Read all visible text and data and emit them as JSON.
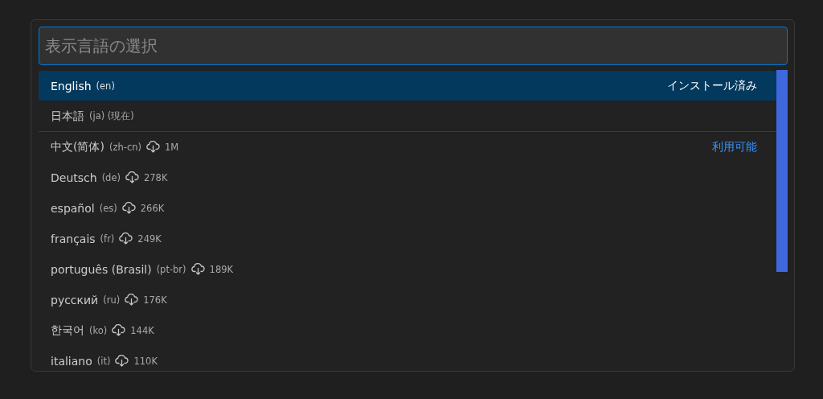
{
  "search": {
    "placeholder": "表示言語の選択"
  },
  "items": [
    {
      "name": "English",
      "code": "(en)",
      "group_label": "インストール済み",
      "selected": true
    },
    {
      "name": "日本語",
      "code": "(ja) (現在)",
      "selected": false
    },
    {
      "name": "中文(简体)",
      "code": "(zh-cn)",
      "size": "1M",
      "group_label": "利用可能",
      "selected": false
    },
    {
      "name": "Deutsch",
      "code": "(de)",
      "size": "278K",
      "selected": false
    },
    {
      "name": "español",
      "code": "(es)",
      "size": "266K",
      "selected": false
    },
    {
      "name": "français",
      "code": "(fr)",
      "size": "249K",
      "selected": false
    },
    {
      "name": "português (Brasil)",
      "code": "(pt-br)",
      "size": "189K",
      "selected": false
    },
    {
      "name": "русский",
      "code": "(ru)",
      "size": "176K",
      "selected": false
    },
    {
      "name": "한국어",
      "code": "(ko)",
      "size": "144K",
      "selected": false
    },
    {
      "name": "italiano",
      "code": "(it)",
      "size": "110K",
      "selected": false
    }
  ]
}
